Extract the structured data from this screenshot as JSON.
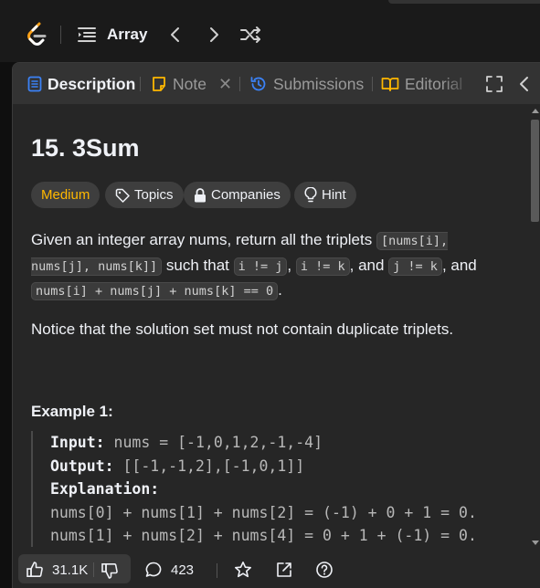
{
  "nav": {
    "breadcrumb": "Array"
  },
  "tabs": {
    "description": "Description",
    "note": "Note",
    "submissions": "Submissions",
    "editorial": "Editorial"
  },
  "problem": {
    "title": "15. 3Sum",
    "difficulty": "Medium",
    "topics": "Topics",
    "companies": "Companies",
    "hint": "Hint",
    "p1": {
      "t1": "Given an integer array nums, return all the triplets ",
      "c1": "[nums[i], nums[j], nums[k]]",
      "t2": " such that ",
      "c2": "i != j",
      "t3": ", ",
      "c3": "i != k",
      "t4": ", and ",
      "c4": "j != k",
      "t5": ", and ",
      "c5": "nums[i] + nums[j] + nums[k] == 0",
      "t6": "."
    },
    "p2": "Notice that the solution set must not contain duplicate triplets.",
    "example_title": "Example 1:",
    "example": {
      "input_label": "Input:",
      "input_value": " nums = [-1,0,1,2,-1,-4]",
      "output_label": "Output:",
      "output_value": " [[-1,-1,2],[-1,0,1]]",
      "explanation_label": "Explanation:",
      "line1": "nums[0] + nums[1] + nums[2] = (-1) + 0 + 1 = 0.",
      "line2": "nums[1] + nums[2] + nums[4] = 0 + 1 + (-1) = 0."
    }
  },
  "footer": {
    "likes": "31.1K",
    "comments": "423"
  },
  "colors": {
    "difficulty_medium": "#ffb800",
    "description_tab_icon": "#3b82f6",
    "note_tab_icon": "#ffb800",
    "submissions_tab_icon": "#3b82f6",
    "editorial_tab_icon": "#ffb800"
  },
  "icons": [
    "leetcode-logo",
    "list-icon",
    "chevron-left-icon",
    "chevron-right-icon",
    "shuffle-icon",
    "description-icon",
    "note-icon",
    "close-icon",
    "history-icon",
    "book-icon",
    "expand-icon",
    "collapse-icon",
    "tag-icon",
    "lock-icon",
    "lightbulb-icon",
    "thumbs-up-icon",
    "thumbs-down-icon",
    "comment-icon",
    "star-icon",
    "share-icon",
    "help-icon"
  ]
}
